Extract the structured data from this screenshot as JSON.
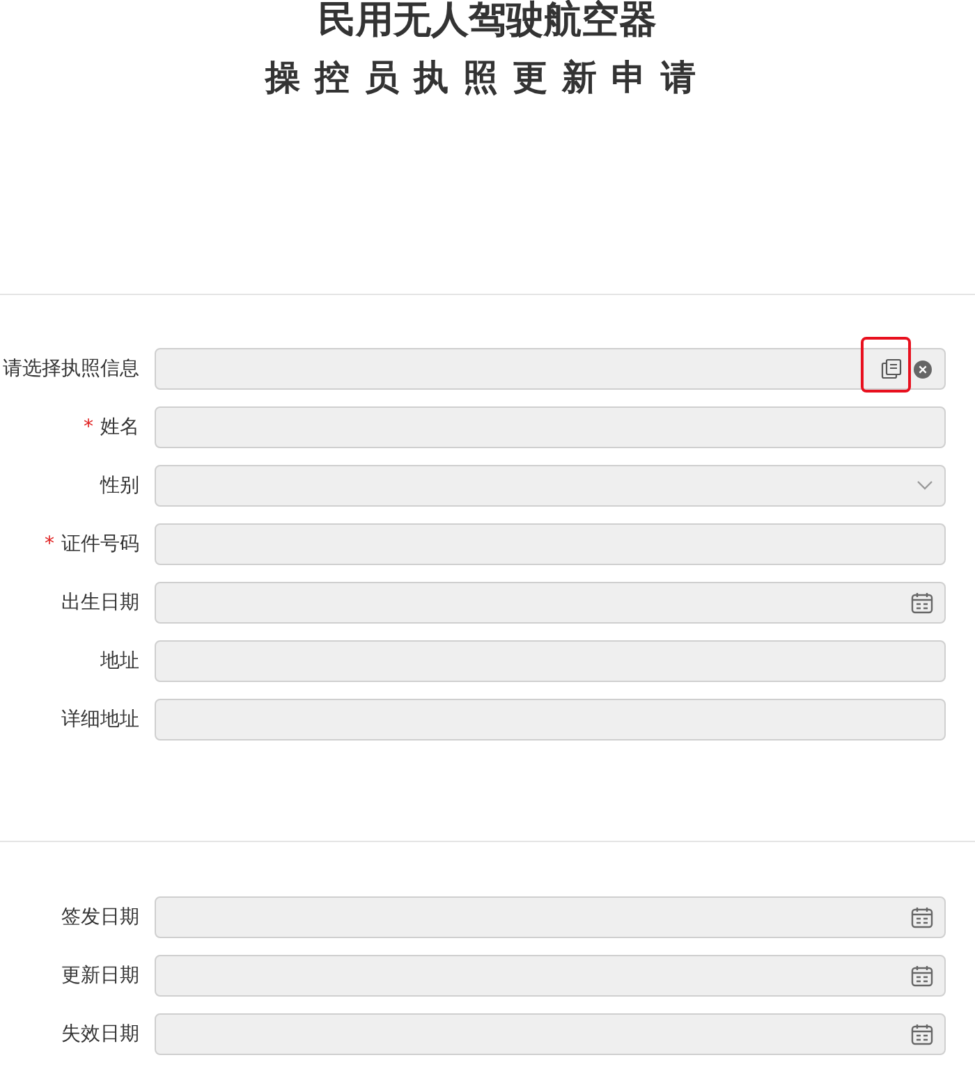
{
  "title": {
    "line_1": "民用无人驾驶航空器",
    "line_2": "操控员执照更新申请"
  },
  "sections": [
    {
      "fields": [
        {
          "label": "请选择执照信息",
          "kind": "picker",
          "highlighted": true
        },
        {
          "label": "姓名",
          "kind": "text",
          "required_mark": "*"
        },
        {
          "label": "性别",
          "kind": "select"
        },
        {
          "label": "证件号码",
          "kind": "text",
          "required_mark": "*"
        },
        {
          "label": "出生日期",
          "kind": "date"
        },
        {
          "label": "地址",
          "kind": "text"
        },
        {
          "label": "详细地址",
          "kind": "text"
        }
      ]
    },
    {
      "fields": [
        {
          "label": "签发日期",
          "kind": "date"
        },
        {
          "label": "更新日期",
          "kind": "date"
        },
        {
          "label": "失效日期",
          "kind": "date"
        }
      ]
    }
  ]
}
